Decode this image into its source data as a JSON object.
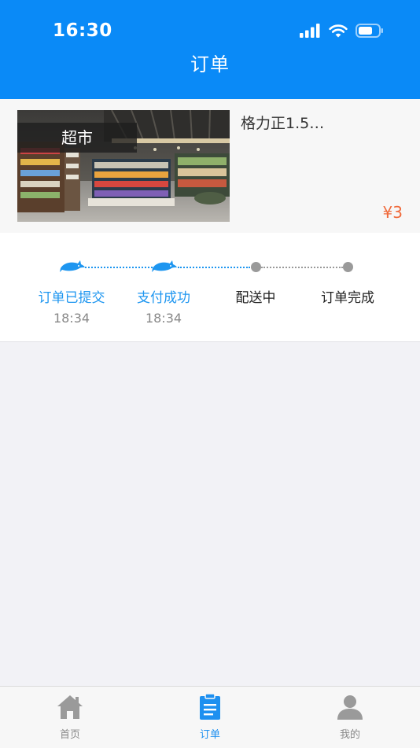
{
  "status_bar": {
    "time": "16:30"
  },
  "header": {
    "title": "订单"
  },
  "order": {
    "store_badge": "超市",
    "product_name": "格力正1.5…",
    "price": "¥3"
  },
  "progress": {
    "steps": [
      {
        "label": "订单已提交",
        "time": "18:34",
        "done": true
      },
      {
        "label": "支付成功",
        "time": "18:34",
        "done": true
      },
      {
        "label": "配送中",
        "time": "",
        "done": false
      },
      {
        "label": "订单完成",
        "time": "",
        "done": false
      }
    ]
  },
  "tabbar": {
    "items": [
      {
        "label": "首页",
        "icon": "home-icon",
        "active": false
      },
      {
        "label": "订单",
        "icon": "order-icon",
        "active": true
      },
      {
        "label": "我的",
        "icon": "profile-icon",
        "active": false
      }
    ]
  },
  "colors": {
    "header_blue": "#0a8af7",
    "accent_blue": "#1e96f0",
    "price_orange": "#f06a3b"
  }
}
